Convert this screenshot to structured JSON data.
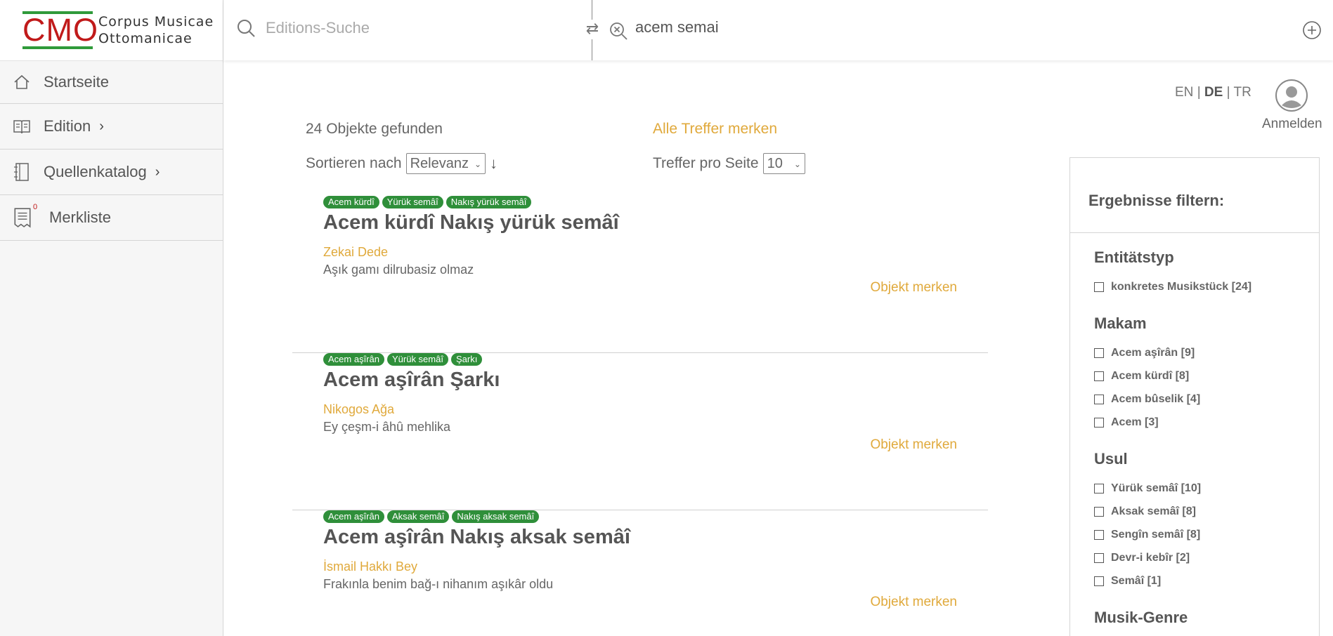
{
  "logo": {
    "abbr": "CMO",
    "line1": "Corpus Musicae",
    "line2": "Ottomanicae"
  },
  "sidebar": {
    "items": [
      {
        "label": "Startseite",
        "icon": "home-icon"
      },
      {
        "label": "Edition",
        "icon": "book-icon",
        "has_submenu": true
      },
      {
        "label": "Quellenkatalog",
        "icon": "notebook-icon",
        "has_submenu": true
      },
      {
        "label": "Merkliste",
        "icon": "list-icon",
        "badge": "0"
      }
    ]
  },
  "search": {
    "edition_placeholder": "Editions-Suche",
    "query": "acem semai"
  },
  "header": {
    "lang_en": "EN",
    "lang_de": "DE",
    "lang_tr": "TR",
    "sep": "|",
    "login": "Anmelden"
  },
  "results": {
    "count_text": "24 Objekte gefunden",
    "save_all": "Alle Treffer merken",
    "sort_label": "Sortieren nach",
    "sort_value": "Relevanz",
    "sort_dir": "↓",
    "per_page_label": "Treffer pro Seite",
    "per_page_value": "10",
    "items": [
      {
        "tags": [
          "Acem kürdî",
          "Yürük semâî",
          "Nakış yürük semâî"
        ],
        "title": "Acem kürdî Nakış yürük semâî",
        "composer": "Zekai Dede",
        "incipit": "Aşık gamı dilrubasiz olmaz",
        "mark": "Objekt merken"
      },
      {
        "tags": [
          "Acem aşîrân",
          "Yürük semâî",
          "Şarkı"
        ],
        "title": "Acem aşîrân Şarkı",
        "composer": "Nikogos Ağa",
        "incipit": "Ey çeşm-i âhû mehlika",
        "mark": "Objekt merken"
      },
      {
        "tags": [
          "Acem aşîrân",
          "Aksak semâî",
          "Nakış aksak semâî"
        ],
        "title": "Acem aşîrân Nakış aksak semâî",
        "composer": "İsmail Hakkı Bey",
        "incipit": "Frakınla benim bağ-ı nihanım aşıkâr oldu",
        "mark": "Objekt merken"
      }
    ]
  },
  "filter": {
    "heading": "Ergebnisse filtern:",
    "sections": [
      {
        "title": "Entitätstyp",
        "options": [
          "konkretes Musikstück [24]"
        ]
      },
      {
        "title": "Makam",
        "options": [
          "Acem aşîrân [9]",
          "Acem kürdî [8]",
          "Acem bûselik [4]",
          "Acem [3]"
        ]
      },
      {
        "title": "Usul",
        "options": [
          "Yürük semâî [10]",
          "Aksak semâî [8]",
          "Sengîn semâî [8]",
          "Devr-i kebîr [2]",
          "Semâî [1]"
        ]
      },
      {
        "title": "Musik-Genre",
        "options": []
      }
    ]
  },
  "colors": {
    "accent": "#e0a93b",
    "tag_green": "#2f8f3a",
    "logo_red": "#c01a1a",
    "logo_green": "#2f9a3a"
  }
}
